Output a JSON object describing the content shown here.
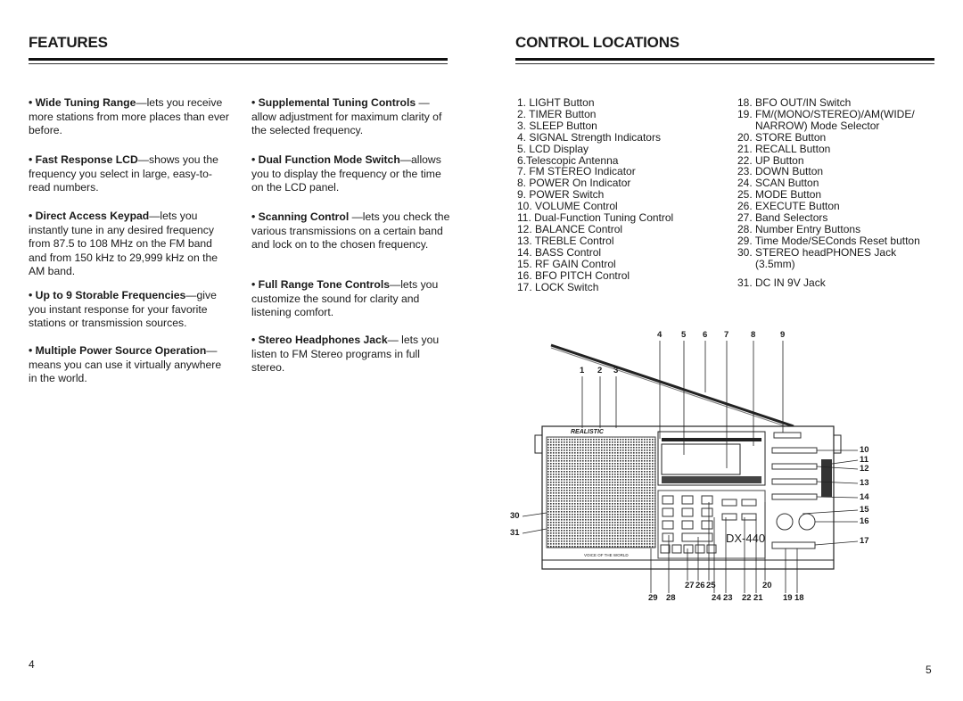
{
  "left_page": {
    "heading": "FEATURES",
    "page_number": "4",
    "features_col1": [
      {
        "lead": "Wide Tuning Range",
        "text": "—lets you receive more stations from more places than ever before."
      },
      {
        "lead": "Fast Response LCD",
        "text": "—shows you the frequency you select in large, easy-to-read numbers."
      },
      {
        "lead": "Direct Access Keypad",
        "text": "—lets you instantly tune in any desired frequency from 87.5 to 108 MHz on the FM band and from 150 kHz to 29,999 kHz on the AM band."
      },
      {
        "lead": "Up to 9 Storable Frequencies",
        "text": "—give you instant response for your favorite stations or transmission sources."
      },
      {
        "lead": "Multiple Power Source Operation",
        "text": "— means you can use it virtually anywhere in the world."
      }
    ],
    "features_col2": [
      {
        "lead": "Supplemental Tuning Controls",
        "text": " — allow adjustment for maximum clarity of the selected frequency."
      },
      {
        "lead": "Dual Function Mode Switch",
        "text": "—allows you to display the frequency or the time on the LCD panel."
      },
      {
        "lead": "Scanning Control",
        "text": " —lets you check the various transmissions on a certain band and lock on to the chosen frequency."
      },
      {
        "lead": "Full Range Tone Controls",
        "text": "—lets you customize the sound for clarity and listening comfort."
      },
      {
        "lead": "Stereo Headphones Jack",
        "text": "— lets you listen to FM Stereo programs in full stereo."
      }
    ]
  },
  "right_page": {
    "heading": "CONTROL LOCATIONS",
    "page_number": "5",
    "controls_col1": [
      "1. LIGHT Button",
      "2. TIMER Button",
      "3. SLEEP Button",
      "4. SIGNAL Strength Indicators",
      "5. LCD Display",
      "6.Telescopic Antenna",
      "7. FM STEREO Indicator",
      "8. POWER On Indicator",
      "9. POWER Switch",
      "10. VOLUME Control",
      "11. Dual-Function Tuning Control",
      "12. BALANCE Control",
      "13. TREBLE Control",
      "14. BASS Control",
      "15. RF GAIN Control",
      "16. BFO PITCH Control",
      "17. LOCK Switch"
    ],
    "controls_col2": [
      "18. BFO OUT/IN Switch",
      "19. FM/(MONO/STEREO)/AM(WIDE/",
      "NARROW) Mode Selector",
      "20. STORE Button",
      "21. RECALL Button",
      "22. UP Button",
      "23. DOWN Button",
      "24. SCAN Button",
      "25. MODE Button",
      "26. EXECUTE Button",
      "27. Band Selectors",
      "28. Number Entry Buttons",
      "29. Time Mode/SEConds Reset button",
      "30. STEREO headPHONES Jack",
      "(3.5mm)",
      "31. DC IN 9V Jack"
    ],
    "diagram": {
      "brand": "REALISTIC",
      "model": "DX-440",
      "slogan": "VOICE OF THE WORLD",
      "callouts": [
        "1",
        "2",
        "3",
        "4",
        "5",
        "6",
        "7",
        "8",
        "9",
        "10",
        "11",
        "12",
        "13",
        "14",
        "15",
        "16",
        "17",
        "18",
        "19",
        "20",
        "21",
        "22",
        "23",
        "24",
        "25",
        "26",
        "27",
        "28",
        "29",
        "30",
        "31"
      ]
    }
  }
}
